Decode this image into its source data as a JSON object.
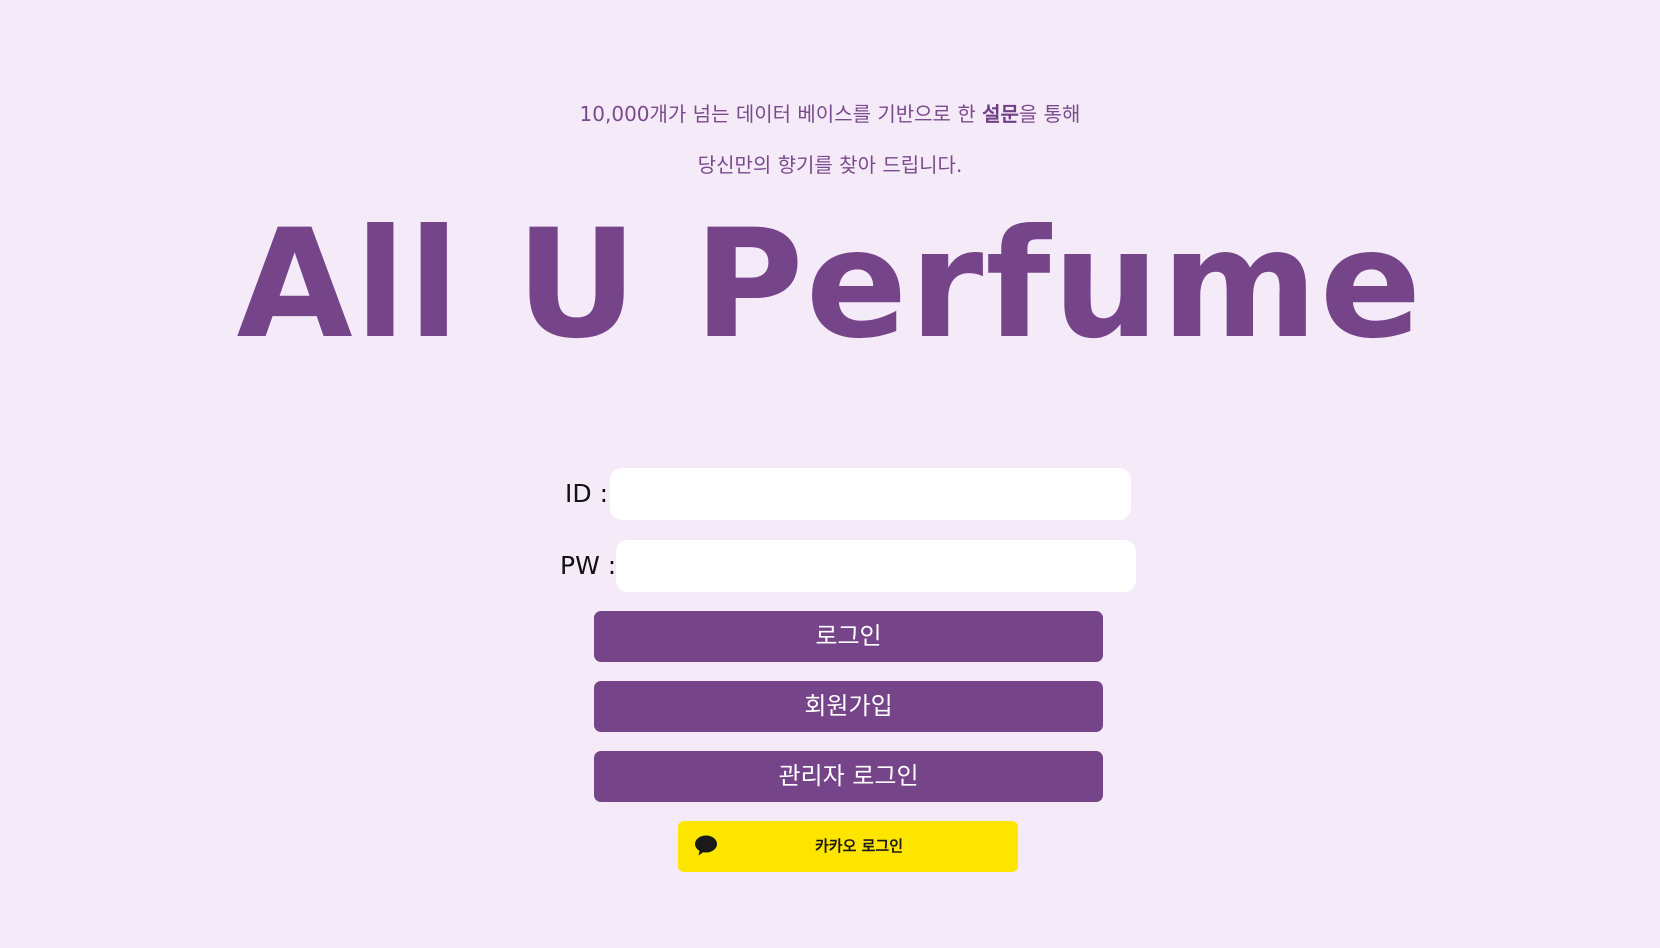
{
  "tagline": {
    "line1_prefix": "10,000개가 넘는 데이터 베이스를 기반으로 한 ",
    "line1_bold": "설문",
    "line1_suffix": "을 통해",
    "line2": "당신만의 향기를 찾아 드립니다."
  },
  "brand": {
    "title": "All U Perfume",
    "color": "#764489"
  },
  "form": {
    "id_label": "ID :",
    "id_value": "",
    "pw_label": "PW :",
    "pw_value": ""
  },
  "buttons": {
    "login": "로그인",
    "signup": "회원가입",
    "admin_login": "관리자 로그인",
    "kakao_login": "카카오 로그인",
    "kakao_icon": "speech-bubble-icon"
  },
  "colors": {
    "background": "#f5ebf8",
    "accent": "#764489",
    "kakao": "#fee500"
  }
}
